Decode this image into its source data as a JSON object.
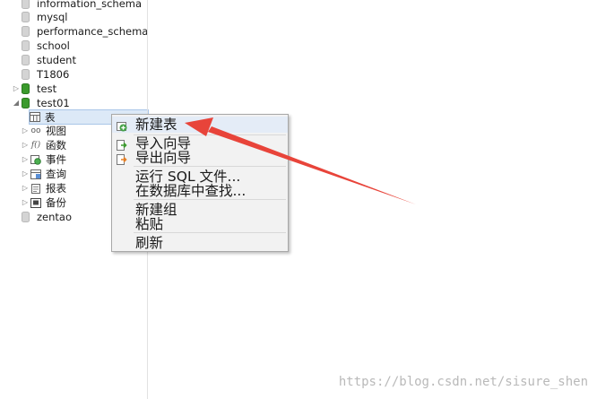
{
  "tree": {
    "databases_top": [
      {
        "name": "information_schema"
      },
      {
        "name": "mysql"
      },
      {
        "name": "performance_schema"
      },
      {
        "name": "school"
      },
      {
        "name": "student"
      },
      {
        "name": "T1806"
      }
    ],
    "test": {
      "name": "test"
    },
    "test01": {
      "name": "test01",
      "children": [
        {
          "name": "表",
          "icon": "table-icon",
          "selected": true
        },
        {
          "name": "视图",
          "icon": "view-icon"
        },
        {
          "name": "函数",
          "icon": "function-icon"
        },
        {
          "name": "事件",
          "icon": "event-icon"
        },
        {
          "name": "查询",
          "icon": "query-icon"
        },
        {
          "name": "报表",
          "icon": "report-icon"
        },
        {
          "name": "备份",
          "icon": "backup-icon"
        }
      ]
    },
    "zentao": {
      "name": "zentao"
    }
  },
  "context_menu": {
    "new_table": "新建表",
    "import_wizard": "导入向导",
    "export_wizard": "导出向导",
    "run_sql_file": "运行 SQL 文件...",
    "find_in_db": "在数据库中查找...",
    "new_group": "新建组",
    "paste": "粘贴",
    "refresh": "刷新"
  },
  "watermark": "https://blog.csdn.net/sisure_shen",
  "colors": {
    "annotation_arrow": "#e8443a",
    "db_active": "#3a9a2c",
    "selection": "#dce9f7"
  }
}
